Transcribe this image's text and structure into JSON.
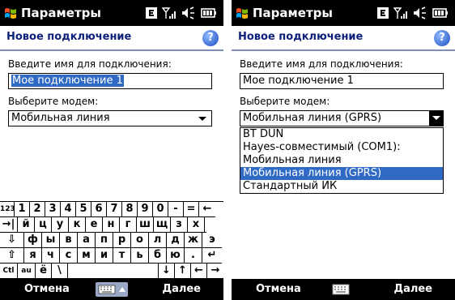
{
  "status_bar": {
    "title": "Параметры"
  },
  "header": {
    "title": "Новое подключение",
    "help_glyph": "?"
  },
  "form": {
    "name_label": "Введите имя для подключения:",
    "name_value": "Мое подключение 1",
    "modem_label": "Выберите модем:"
  },
  "left": {
    "modem_value": "Мобильная линия"
  },
  "right": {
    "modem_value": "Мобильная линия (GPRS)",
    "dropdown_options": [
      "BT DUN",
      "Hayes-совместимый (COM1):",
      "Мобильная линия",
      "Мобильная линия (GPRS)",
      "Стандартный ИК"
    ],
    "selected_option": "Мобильная линия (GPRS)"
  },
  "keyboard": {
    "row1": [
      "123",
      "1",
      "2",
      "3",
      "4",
      "5",
      "6",
      "7",
      "8",
      "9",
      "0",
      "-",
      "=",
      "←"
    ],
    "row2": [
      "→|",
      "й",
      "ц",
      "у",
      "к",
      "е",
      "н",
      "г",
      "ш",
      "щ",
      "з",
      "х",
      "ъ"
    ],
    "row3": [
      "⇩",
      "ф",
      "ы",
      "в",
      "а",
      "п",
      "р",
      "о",
      "л",
      "д",
      "ж",
      "э"
    ],
    "row4": [
      "⇧",
      "я",
      "ч",
      "с",
      "м",
      "и",
      "т",
      "ь",
      "б",
      "ю",
      ".",
      "↵"
    ],
    "row5": [
      "Ctl",
      "au",
      "ё",
      "\\",
      "",
      "↓",
      "↑",
      "←",
      "→"
    ]
  },
  "softkeys": {
    "left": "Отмена",
    "right": "Далее"
  },
  "icons": {
    "start": "windows-flag-icon",
    "status": [
      "e-mail-indicator-icon",
      "signal-strength-icon",
      "volume-icon",
      "battery-icon"
    ],
    "keyboard_toggle": "keyboard-icon"
  },
  "colors": {
    "bar": "#000000",
    "header_text": "#0c1f7a",
    "selection": "#316ac5",
    "divider": "#7d8fb8"
  }
}
